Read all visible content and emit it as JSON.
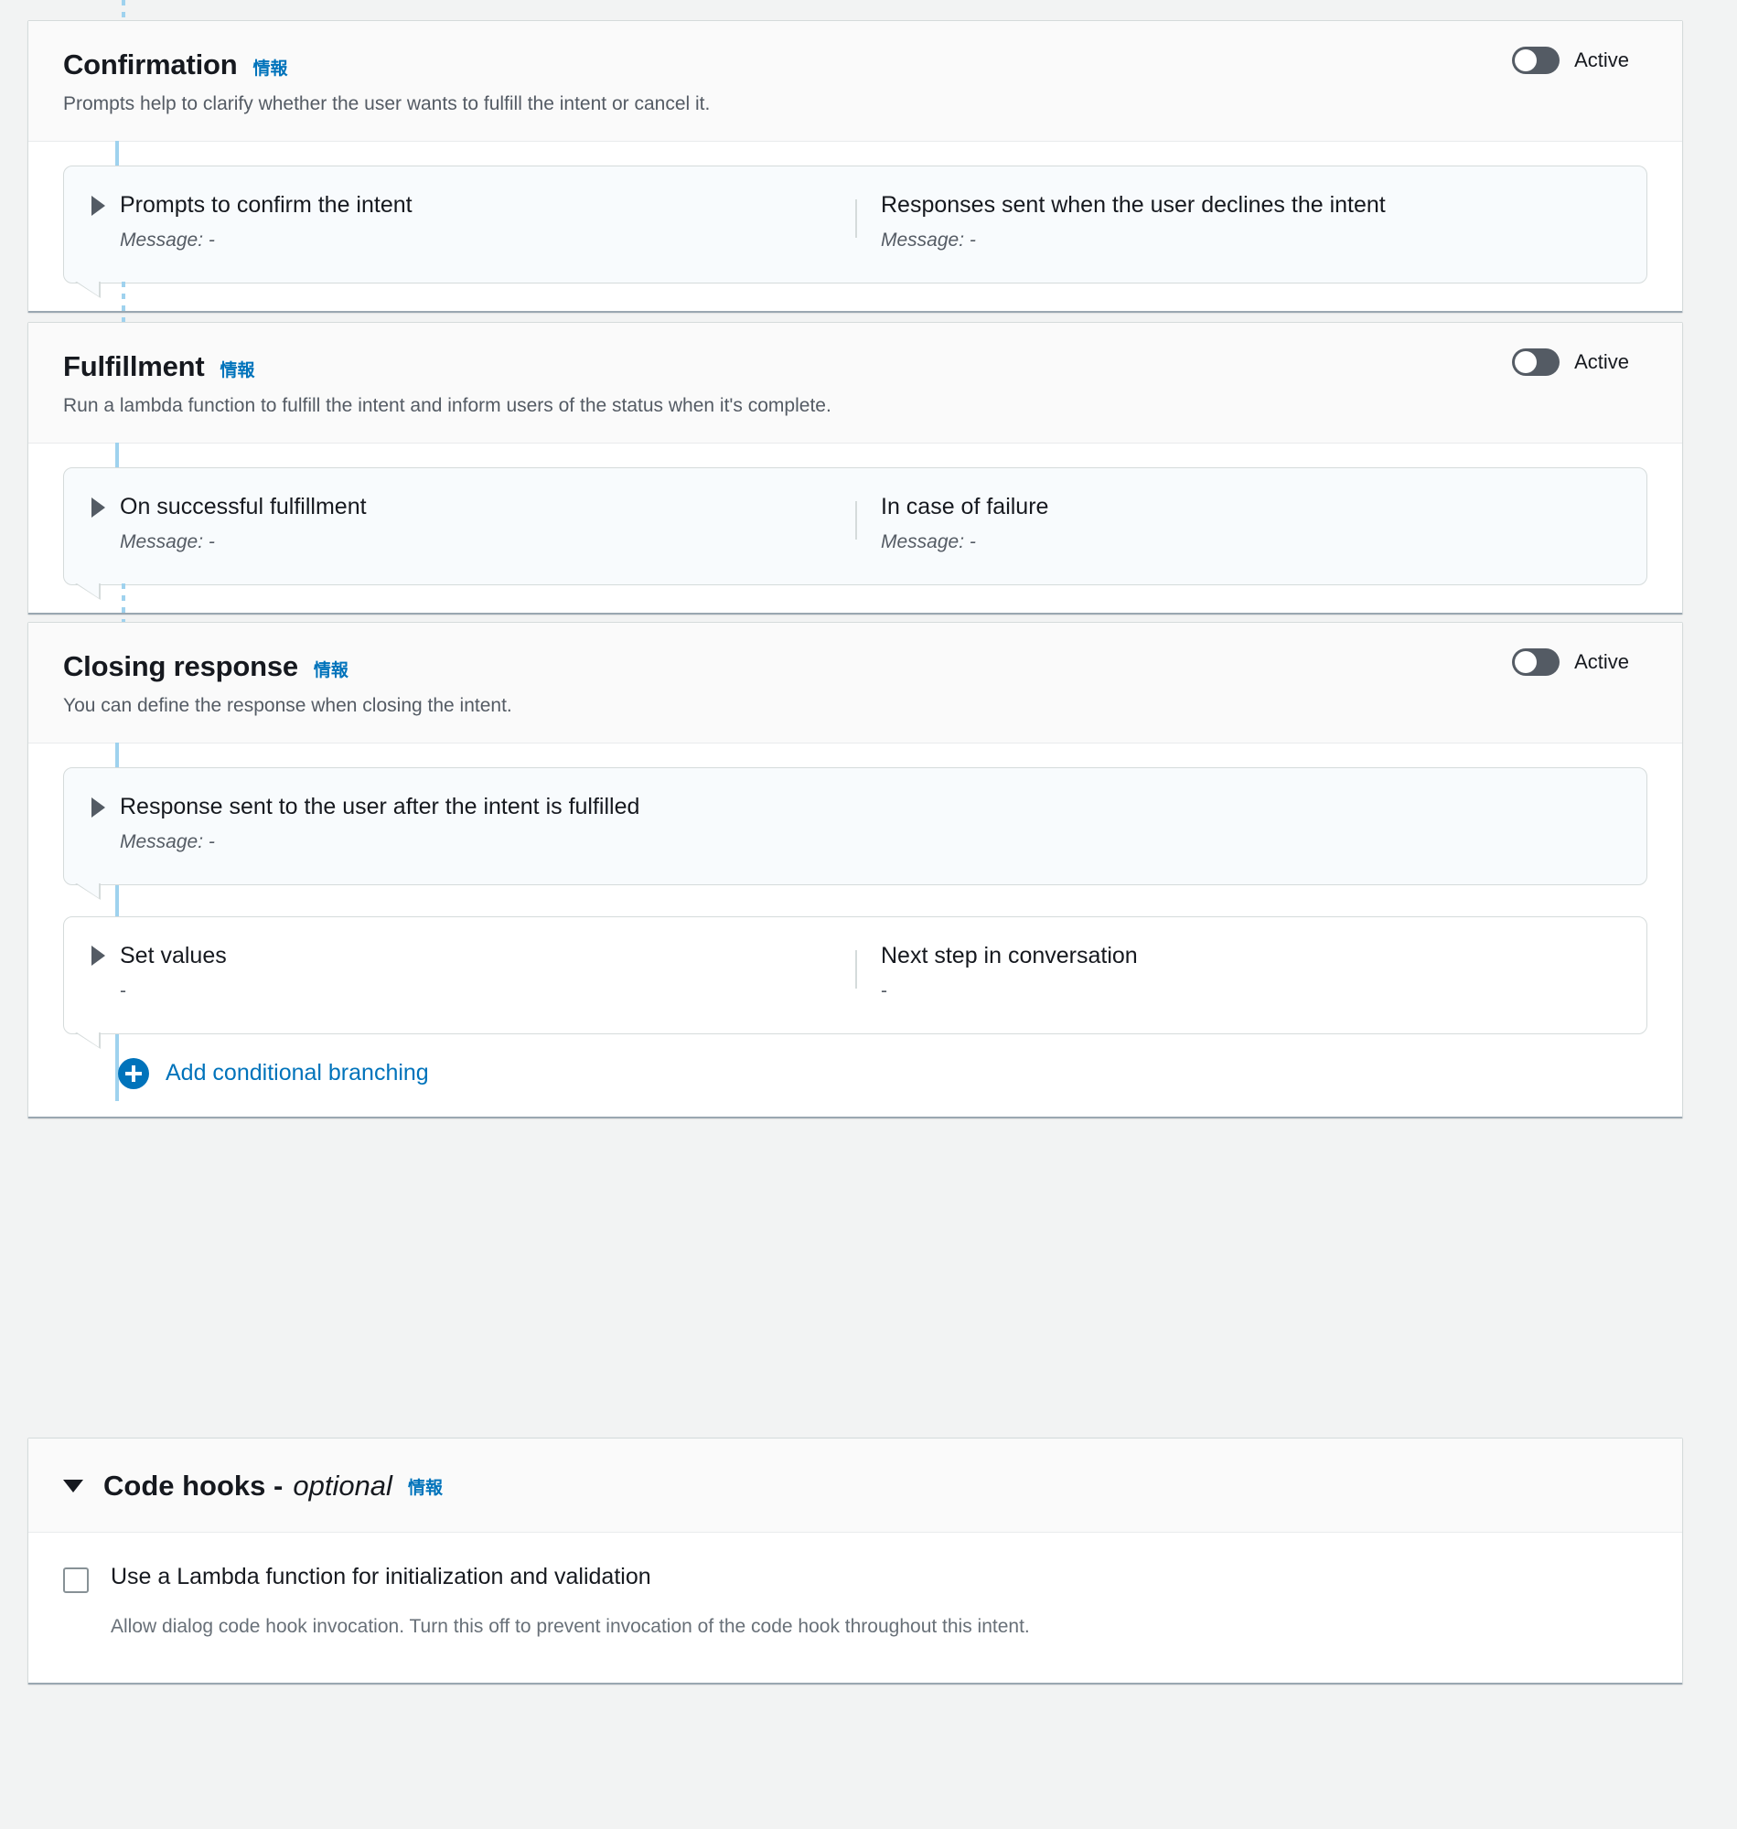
{
  "info_label": "情報",
  "sections": [
    {
      "id": "confirmation",
      "title": "Confirmation",
      "description": "Prompts help to clarify whether the user wants to fulfill the intent or cancel it.",
      "toggle_label": "Active",
      "toggle_state": "off",
      "cards": [
        {
          "style": "highlight",
          "left": {
            "title": "Prompts to confirm the intent",
            "value": "Message: -"
          },
          "right": {
            "title": "Responses sent when the user declines the intent",
            "value": "Message: -"
          }
        }
      ]
    },
    {
      "id": "fulfillment",
      "title": "Fulfillment",
      "description": "Run a lambda function to fulfill the intent and inform users of the status when it's complete.",
      "toggle_label": "Active",
      "toggle_state": "off",
      "cards": [
        {
          "style": "highlight",
          "left": {
            "title": "On successful fulfillment",
            "value": "Message: -"
          },
          "right": {
            "title": "In case of failure",
            "value": "Message: -"
          }
        }
      ]
    },
    {
      "id": "closing-response",
      "title": "Closing response",
      "description": "You can define the response when closing the intent.",
      "toggle_label": "Active",
      "toggle_state": "off",
      "cards": [
        {
          "style": "highlight",
          "left": {
            "title": "Response sent to the user after the intent is fulfilled",
            "value": "Message: -"
          },
          "right": null
        },
        {
          "style": "plain",
          "left": {
            "title": "Set values",
            "value": "-"
          },
          "right": {
            "title": "Next step in conversation",
            "value": "-"
          }
        }
      ],
      "add_link": "Add conditional branching"
    }
  ],
  "code_hooks": {
    "title": "Code hooks -",
    "optional": "optional",
    "info_label": "情報",
    "checkbox": {
      "checked": false,
      "label": "Use a Lambda function for initialization and validation",
      "description": "Allow dialog code hook invocation. Turn this off to prevent invocation of the code hook throughout this intent."
    }
  },
  "colors": {
    "accent": "#0073bb",
    "connector": "#9fd2ee",
    "toggle_off_track": "#545b64",
    "card_highlight_bg": "#f8fbfd",
    "page_bg": "#f2f3f3"
  }
}
